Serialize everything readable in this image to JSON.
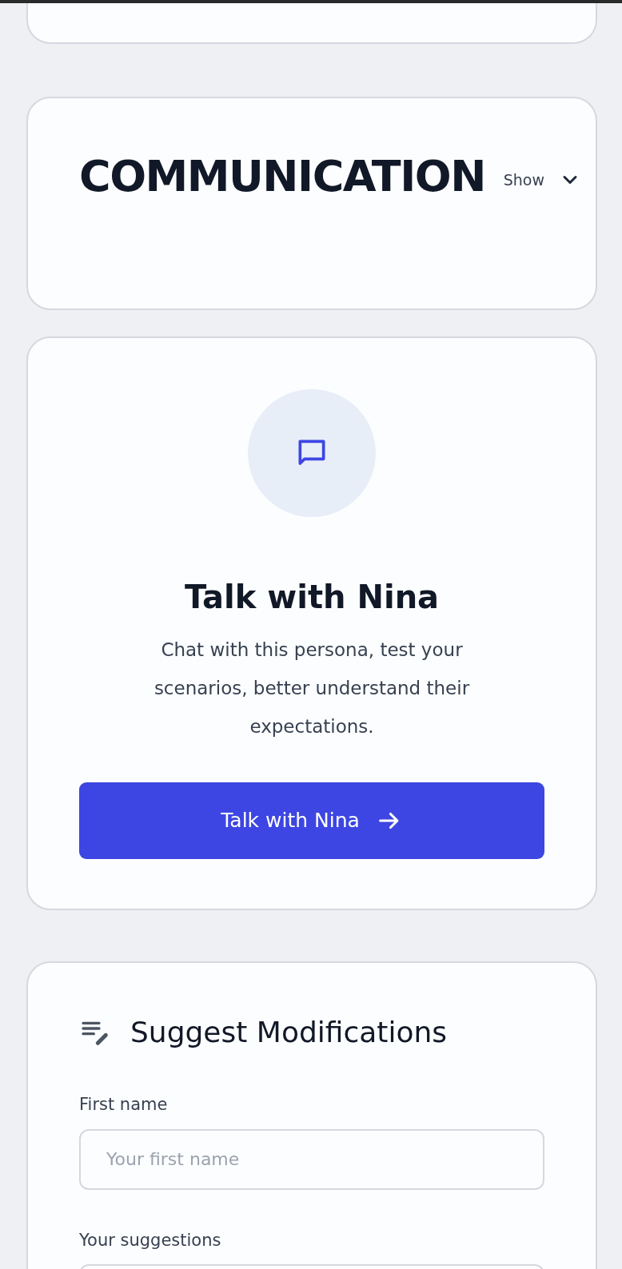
{
  "section": {
    "title": "COMMUNICATION",
    "toggle_label": "Show",
    "expanded": false
  },
  "chat_card": {
    "title": "Talk with Nina",
    "description": "Chat with this persona, test your scenarios, better understand their expectations.",
    "button": "Talk with Nina"
  },
  "suggest_form": {
    "title": "Suggest Modifications",
    "fields": [
      {
        "kind": "input",
        "label": "First name",
        "placeholder": "Your first name"
      },
      {
        "kind": "textarea",
        "label": "Your suggestions"
      }
    ]
  }
}
